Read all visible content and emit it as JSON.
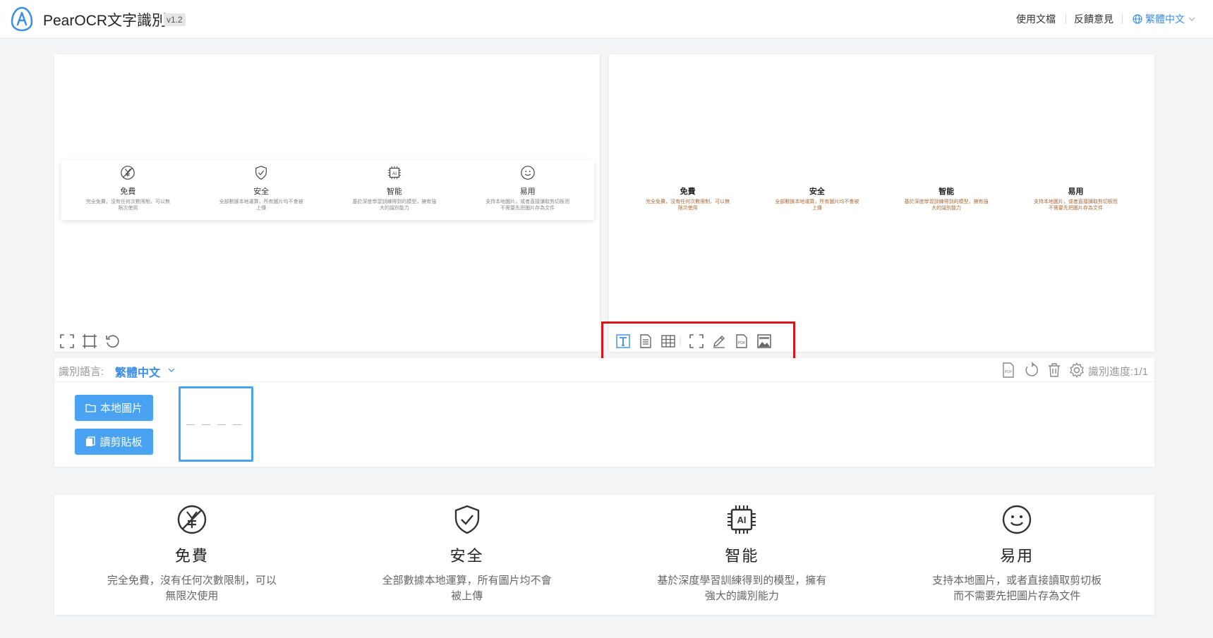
{
  "app": {
    "title": "PearOCR文字識別",
    "version": "v1.2"
  },
  "nav": {
    "docs": "使用文檔",
    "feedback": "反饋意見",
    "language": "繁體中文"
  },
  "features": [
    {
      "icon": "yen-free-icon",
      "title": "免費",
      "desc": "完全免費，沒有任何次數限制，可以無限次使用"
    },
    {
      "icon": "shield-check-icon",
      "title": "安全",
      "desc": "全部數據本地運算，所有圖片均不會被上傳"
    },
    {
      "icon": "ai-chip-icon",
      "title": "智能",
      "desc": "基於深度學習訓練得到的模型，擁有強大的識別能力"
    },
    {
      "icon": "smile-icon",
      "title": "易用",
      "desc": "支持本地圖片，或者直接讀取剪切板而不需要先把圖片存為文件"
    }
  ],
  "ocr_result": [
    {
      "title": "免費",
      "desc": "完全免費，沒有任何次數限制，可以無限次使用"
    },
    {
      "title": "安全",
      "desc": "全部數據本地運算，所有圖片均不會被上傳"
    },
    {
      "title": "智能",
      "desc": "基於深度學習訓練得到的模型，擁有強大的識別能力"
    },
    {
      "title": "易用",
      "desc": "支持本地圖片，或者直接讀取剪切板而不需要先把圖片存為文件"
    }
  ],
  "recognition": {
    "label": "識別語言:",
    "value": "繁體中文",
    "progress": "識別進度:1/1"
  },
  "buttons": {
    "local_image": "本地圖片",
    "clipboard": "讀剪貼板"
  },
  "colors": {
    "accent": "#4aa2f2",
    "highlight": "#d9141b"
  }
}
